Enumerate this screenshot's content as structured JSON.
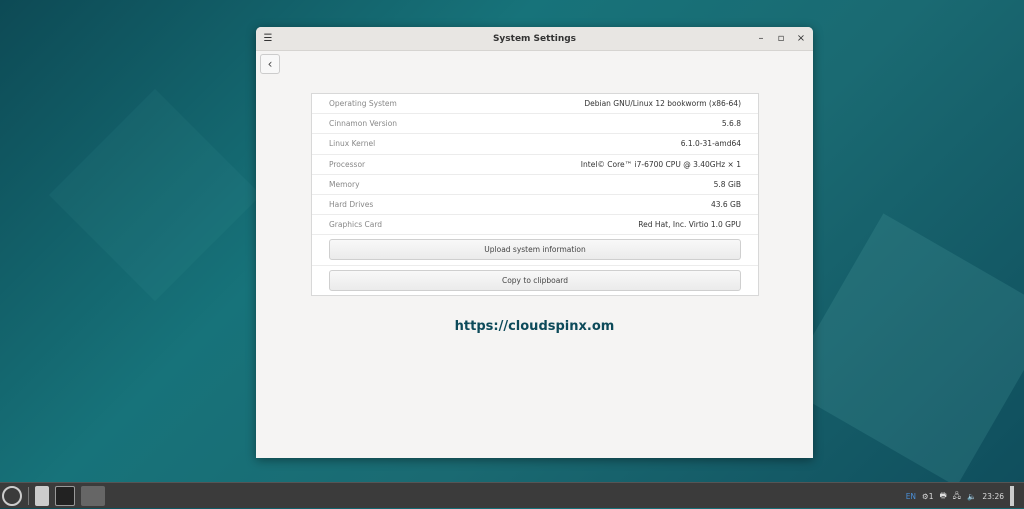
{
  "window": {
    "title": "System Settings",
    "back": "‹",
    "menu": "☰",
    "minimize": "–",
    "maximize": "▫",
    "close": "×"
  },
  "info": [
    {
      "label": "Operating System",
      "value": "Debian GNU/Linux 12 bookworm (x86-64)"
    },
    {
      "label": "Cinnamon Version",
      "value": "5.6.8"
    },
    {
      "label": "Linux Kernel",
      "value": "6.1.0-31-amd64"
    },
    {
      "label": "Processor",
      "value": "Intel© Core™ i7-6700 CPU @ 3.40GHz × 1"
    },
    {
      "label": "Memory",
      "value": "5.8 GiB"
    },
    {
      "label": "Hard Drives",
      "value": "43.6 GB"
    },
    {
      "label": "Graphics Card",
      "value": "Red Hat, Inc. Virtio 1.0 GPU"
    }
  ],
  "buttons": {
    "upload": "Upload system information",
    "copy": "Copy to clipboard"
  },
  "watermark": "https://cloudspinx.om",
  "tray": {
    "lang": "EN",
    "updates": "1",
    "clock": "23:26"
  }
}
